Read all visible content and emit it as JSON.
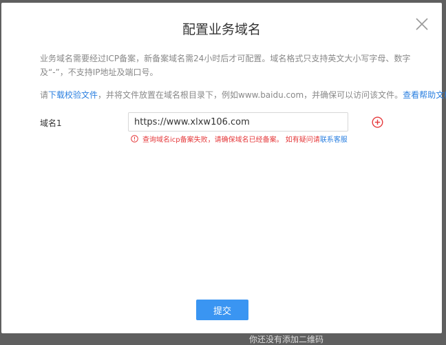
{
  "dialog": {
    "title": "配置业务域名",
    "description": "业务域名需要经过ICP备案，新备案域名需24小时后才可配置。域名格式只支持英文大小写字母、数字及“-”，不支持IP地址及端口号。",
    "hint_prefix": "请",
    "hint_download_link": "下载校验文件",
    "hint_middle": "，并将文件放置在域名根目录下，例如www.baidu.com，并确保可以访问该文件。",
    "hint_help_link": "查看帮助文档",
    "field_label": "域名1",
    "field_value": "https://www.xlxw106.com",
    "error_text": "查询域名icp备案失败，请确保域名已经备案。 如有疑问请",
    "error_link": "联系客服",
    "submit_label": "提交"
  },
  "background": {
    "text": "你还没有添加二维码"
  },
  "colors": {
    "accent": "#3a95f2",
    "error": "#e5393b",
    "link": "#2a7fe0"
  },
  "icons": [
    "close-icon",
    "add-circle-icon",
    "warning-circle-icon"
  ]
}
